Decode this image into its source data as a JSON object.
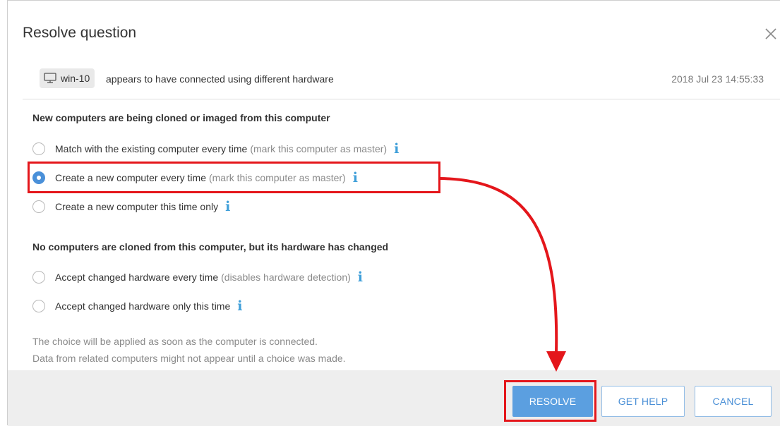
{
  "dialog": {
    "title": "Resolve question",
    "close_icon": "close-icon"
  },
  "notice": {
    "computer_icon": "monitor-icon",
    "computer_name": "win-10",
    "message": "appears to have connected using different hardware",
    "timestamp": "2018 Jul 23 14:55:33"
  },
  "section_cloned": {
    "heading": "New computers are being cloned or imaged from this computer",
    "options": [
      {
        "label": "Match with the existing computer every time",
        "hint": "(mark this computer as master)",
        "selected": false
      },
      {
        "label": "Create a new computer every time",
        "hint": "(mark this computer as master)",
        "selected": true
      },
      {
        "label": "Create a new computer this time only",
        "hint": "",
        "selected": false
      }
    ]
  },
  "section_hardware": {
    "heading": "No computers are cloned from this computer, but its hardware has changed",
    "options": [
      {
        "label": "Accept changed hardware every time",
        "hint": "(disables hardware detection)",
        "selected": false
      },
      {
        "label": "Accept changed hardware only this time",
        "hint": "",
        "selected": false
      }
    ]
  },
  "info_glyph": "i",
  "footnote": {
    "line1": "The choice will be applied as soon as the computer is connected.",
    "line2": "Data from related computers might not appear until a choice was made."
  },
  "buttons": {
    "resolve": "RESOLVE",
    "get_help": "GET HELP",
    "cancel": "CANCEL"
  },
  "colors": {
    "accent": "#5b9fe0",
    "info": "#3f9fd9",
    "annotation": "#e4161b"
  }
}
